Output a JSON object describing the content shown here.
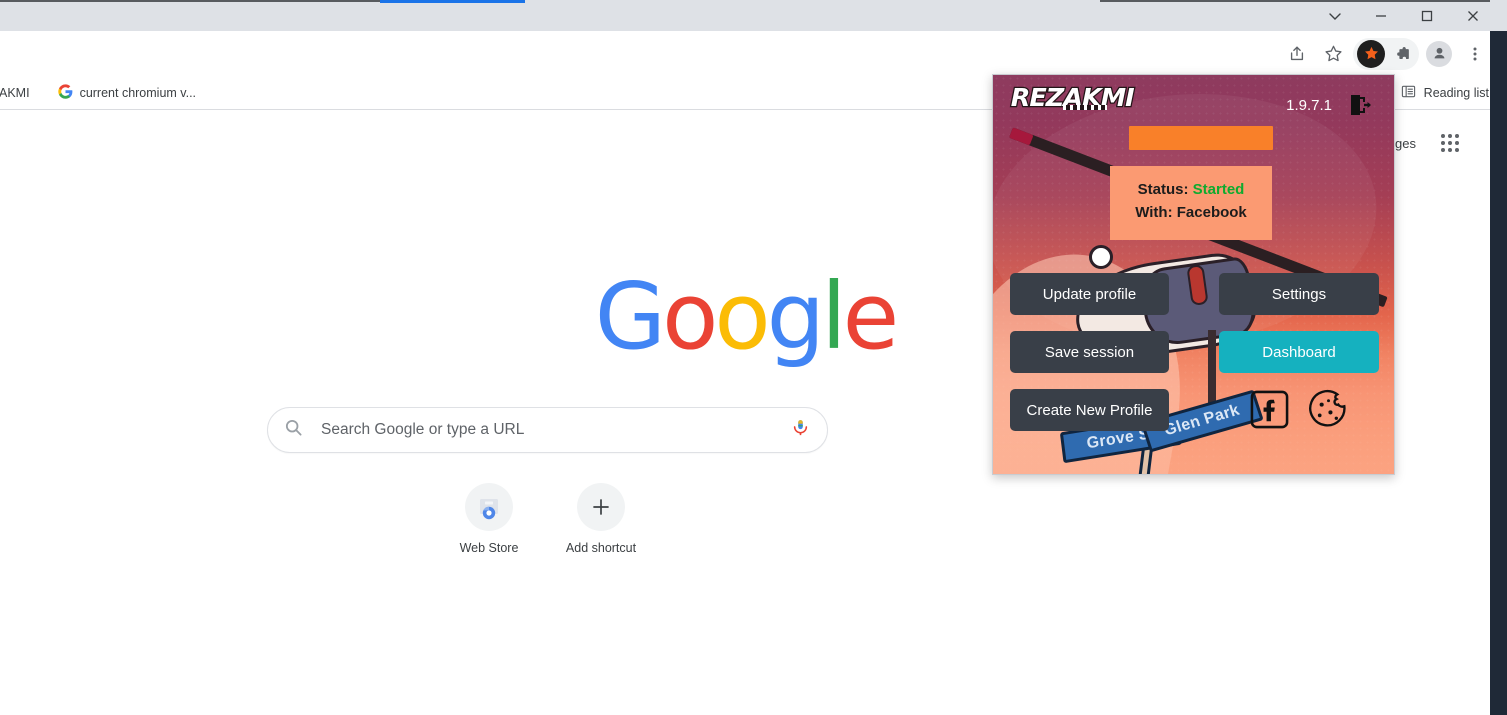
{
  "window": {
    "controls": [
      {
        "name": "tab-search",
        "label": "Search tabs"
      },
      {
        "name": "minimize",
        "label": "Minimize"
      },
      {
        "name": "maximize",
        "label": "Maximize"
      },
      {
        "name": "close",
        "label": "Close"
      }
    ]
  },
  "toolbar": {
    "icons": [
      {
        "name": "share-icon",
        "label": "Share this page"
      },
      {
        "name": "bookmark-star-icon",
        "label": "Bookmark this tab"
      },
      {
        "name": "rezakmi-extension-icon",
        "label": "Rezakmi"
      },
      {
        "name": "extensions-puzzle-icon",
        "label": "Extensions"
      },
      {
        "name": "profile-avatar-icon",
        "label": "Profile"
      },
      {
        "name": "three-dot-menu-icon",
        "label": "Customize and control"
      }
    ]
  },
  "bookmarks": {
    "items": [
      {
        "label": "AKMI",
        "icon": "none"
      },
      {
        "label": "current chromium v...",
        "icon": "google-favicon"
      }
    ],
    "reading_list": "Reading list"
  },
  "newtab": {
    "links": [
      {
        "label": "mages"
      }
    ],
    "apps_grid_label": "Google apps",
    "logo": {
      "letters": [
        {
          "char": "G",
          "color": "#4285f4"
        },
        {
          "char": "o",
          "color": "#ea4335"
        },
        {
          "char": "o",
          "color": "#fbbc05"
        },
        {
          "char": "g",
          "color": "#4285f4"
        },
        {
          "char": "l",
          "color": "#34a853"
        },
        {
          "char": "e",
          "color": "#ea4335"
        }
      ]
    },
    "search": {
      "placeholder": "Search Google or type a URL",
      "value": "",
      "search_icon": "search-icon",
      "voice_icon": "microphone-icon"
    },
    "shortcuts": [
      {
        "label": "Web Store",
        "icon": "web-store-icon"
      },
      {
        "label": "Add shortcut",
        "icon": "plus-icon"
      }
    ]
  },
  "popup": {
    "brand": "REZAKMI",
    "version": "1.9.7.1",
    "logout_icon": "logout-icon",
    "profile_name": "",
    "status": {
      "status_label": "Status:",
      "status_value": "Started",
      "status_color": "#0fab2f",
      "with_label": "With:",
      "with_value": "Facebook"
    },
    "buttons": [
      {
        "name": "update-profile-button",
        "label": "Update profile",
        "color": "#393f48"
      },
      {
        "name": "settings-button",
        "label": "Settings",
        "color": "#393f48"
      },
      {
        "name": "save-session-button",
        "label": "Save session",
        "color": "#393f48"
      },
      {
        "name": "dashboard-button",
        "label": "Dashboard",
        "color": "#15b1bf"
      },
      {
        "name": "create-new-profile-button",
        "label": "Create New Profile",
        "color": "#393f48"
      }
    ],
    "icons": [
      {
        "name": "facebook-icon",
        "label": "Facebook"
      },
      {
        "name": "cookie-icon",
        "label": "Cookies"
      }
    ],
    "illustration": {
      "sign_left": "Grove St",
      "sign_right": "Glen Park"
    },
    "accent_orange": "#f98029",
    "accent_teal": "#15b1bf",
    "panel_peach": "#fb9a72"
  }
}
